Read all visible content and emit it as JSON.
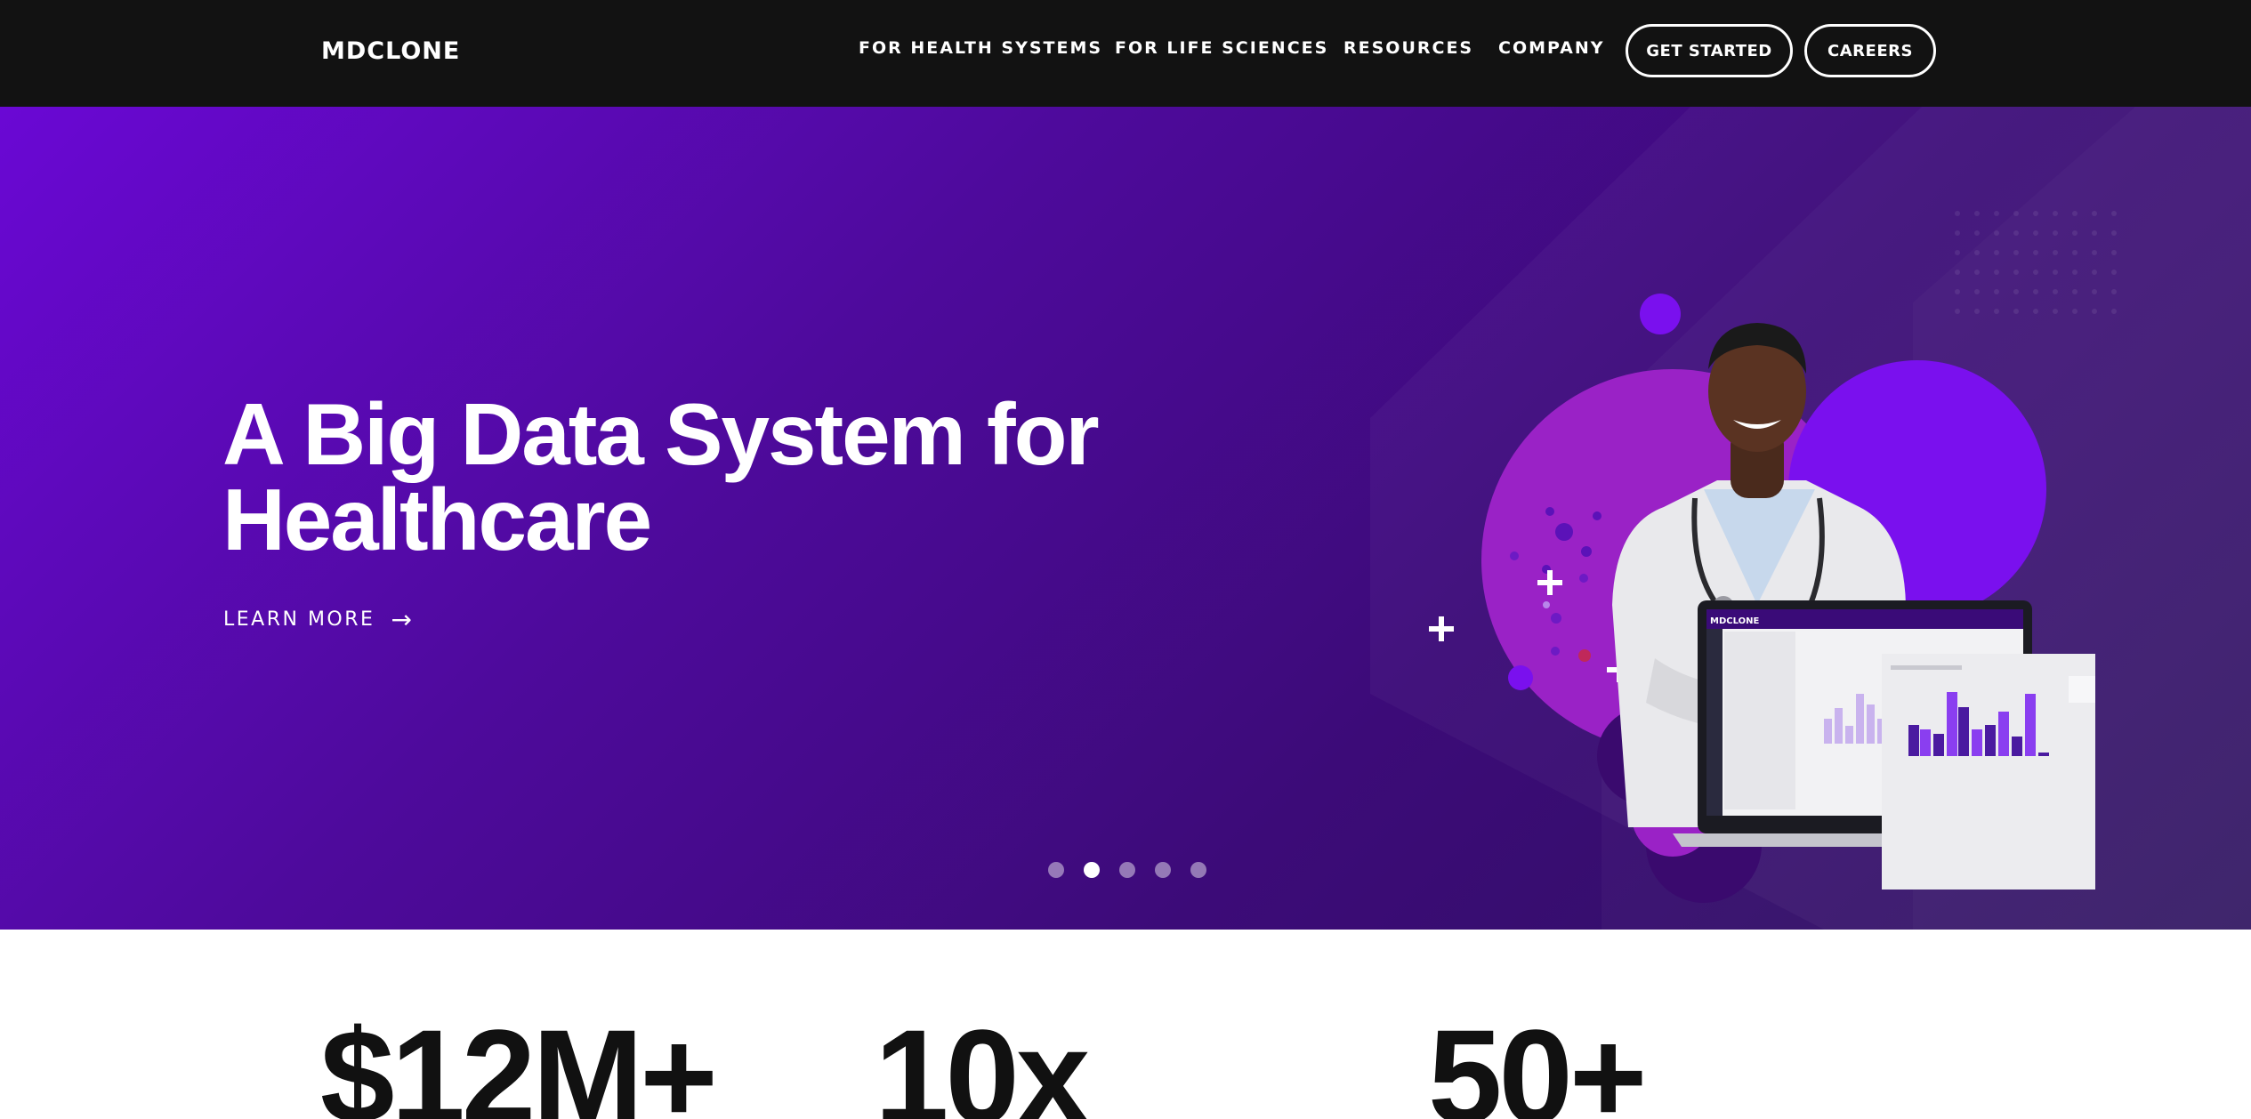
{
  "brand": {
    "logo_text": "MDCLONE"
  },
  "nav": {
    "links": [
      "FOR HEALTH SYSTEMS",
      "FOR LIFE SCIENCES",
      "RESOURCES",
      "COMPANY"
    ],
    "buttons": [
      "GET STARTED",
      "CAREERS"
    ]
  },
  "hero": {
    "title_line1": "A Big Data System for",
    "title_line2": "Healthcare",
    "cta_label": "LEARN MORE",
    "cta_arrow": "→",
    "slides_total": 5,
    "active_slide": 2,
    "screen_logo": "MDCLONE"
  },
  "stats": [
    "$12M+",
    "10x",
    "50+"
  ],
  "colors": {
    "nav_bg": "#121212",
    "hero_purple": "#5a0bb8",
    "accent_violet": "#7a10ee",
    "circle_magenta": "#9a22c6",
    "stat_text": "#111111"
  }
}
